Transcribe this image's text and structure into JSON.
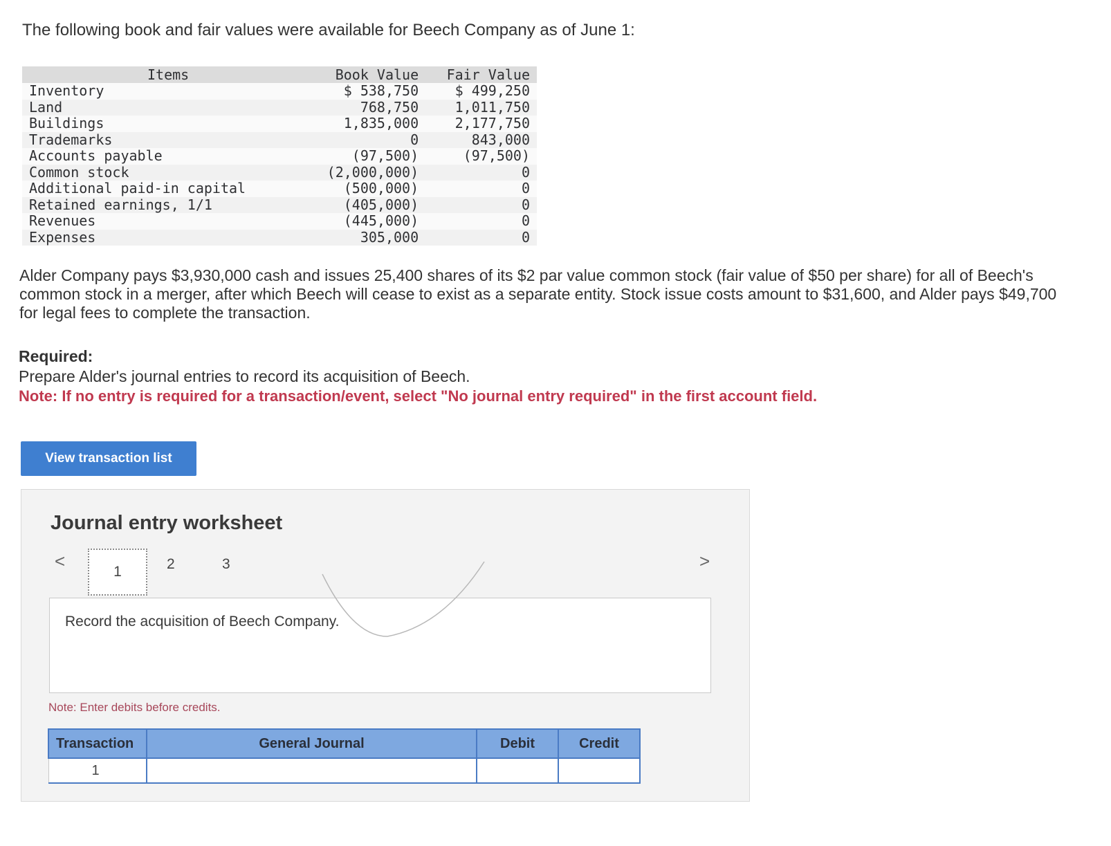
{
  "intro": "The following book and fair values were available for Beech Company as of June 1:",
  "table": {
    "headers": {
      "items": "Items",
      "book": "Book Value",
      "fair": "Fair Value"
    },
    "rows": [
      {
        "item": "Inventory",
        "book": "$ 538,750",
        "fair": "$ 499,250"
      },
      {
        "item": "Land",
        "book": "768,750",
        "fair": "1,011,750"
      },
      {
        "item": "Buildings",
        "book": "1,835,000",
        "fair": "2,177,750"
      },
      {
        "item": "Trademarks",
        "book": "0",
        "fair": "843,000"
      },
      {
        "item": "Accounts payable",
        "book": "(97,500)",
        "fair": "(97,500)"
      },
      {
        "item": "Common stock",
        "book": "(2,000,000)",
        "fair": "0"
      },
      {
        "item": "Additional paid-in capital",
        "book": "(500,000)",
        "fair": "0"
      },
      {
        "item": "Retained earnings, 1/1",
        "book": "(405,000)",
        "fair": "0"
      },
      {
        "item": "Revenues",
        "book": "(445,000)",
        "fair": "0"
      },
      {
        "item": "Expenses",
        "book": "305,000",
        "fair": "0"
      }
    ]
  },
  "description": "Alder Company pays $3,930,000 cash and issues 25,400 shares of its $2 par value common stock (fair value of $50 per share) for all of Beech's common stock in a merger, after which Beech will cease to exist as a separate entity. Stock issue costs amount to $31,600, and Alder pays $49,700 for legal fees to complete the transaction.",
  "required": {
    "heading": "Required:",
    "text": "Prepare Alder's journal entries to record its acquisition of Beech.",
    "note": "Note: If no entry is required for a transaction/event, select \"No journal entry required\" in the first account field."
  },
  "view_button": "View transaction list",
  "worksheet": {
    "title": "Journal entry worksheet",
    "prev": "<",
    "next": ">",
    "pages": [
      "1",
      "2",
      "3"
    ],
    "record_text": "Record the acquisition of Beech Company.",
    "note": "Note: Enter debits before credits.",
    "columns": {
      "transaction": "Transaction",
      "general_journal": "General Journal",
      "debit": "Debit",
      "credit": "Credit"
    },
    "row_transaction": "1"
  }
}
